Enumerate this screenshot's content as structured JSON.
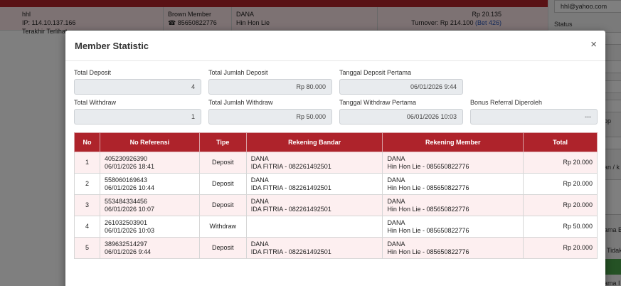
{
  "background": {
    "row": {
      "user": "hhl",
      "ip": "IP: 114.10.137.166",
      "last_login": "Terakhir Terlihat",
      "level": "Brown Member",
      "phone": "85650822776",
      "bank": "DANA",
      "holder": "Hin Hon Lie",
      "balance": "Rp 20.135",
      "turnover_label": "Turnover:",
      "turnover_value": "Rp 214.100",
      "bet_count": "(Bet 426)"
    },
    "right_panel": {
      "email": "hhl@yahoo.com",
      "status_label": "Status",
      "frag_1": "pp",
      "frag_2": "an / k",
      "frag_3": "ama B",
      "frag_4": "Tidak",
      "frag_5": "ama I"
    }
  },
  "modal": {
    "title": "Member Statistic",
    "close_glyph": "×",
    "stats": {
      "total_deposit_label": "Total Deposit",
      "total_deposit_value": "4",
      "total_jumlah_deposit_label": "Total Jumlah Deposit",
      "total_jumlah_deposit_value": "Rp 80.000",
      "tanggal_deposit_pertama_label": "Tanggal Deposit Pertama",
      "tanggal_deposit_pertama_value": "06/01/2026 9:44",
      "total_withdraw_label": "Total Withdraw",
      "total_withdraw_value": "1",
      "total_jumlah_withdraw_label": "Total Jumlah Withdraw",
      "total_jumlah_withdraw_value": "Rp 50.000",
      "tanggal_withdraw_pertama_label": "Tanggal Withdraw Pertama",
      "tanggal_withdraw_pertama_value": "06/01/2026 10:03",
      "bonus_referral_label": "Bonus Referral Diperoleh",
      "bonus_referral_value": "---"
    },
    "table": {
      "headers": [
        "No",
        "No Referensi",
        "Tipe",
        "Rekening Bandar",
        "Rekening Member",
        "Total"
      ],
      "rows": [
        {
          "no": "1",
          "ref": "405230926390",
          "date": "06/01/2026 18:41",
          "tipe": "Deposit",
          "bandar_bank": "DANA",
          "bandar_acc": "IDA FITRIA - 082261492501",
          "member_bank": "DANA",
          "member_acc": "Hin Hon Lie - 085650822776",
          "total": "Rp 20.000"
        },
        {
          "no": "2",
          "ref": "558060169643",
          "date": "06/01/2026 10:44",
          "tipe": "Deposit",
          "bandar_bank": "DANA",
          "bandar_acc": "IDA FITRIA - 082261492501",
          "member_bank": "DANA",
          "member_acc": "Hin Hon Lie - 085650822776",
          "total": "Rp 20.000"
        },
        {
          "no": "3",
          "ref": "553484334456",
          "date": "06/01/2026 10:07",
          "tipe": "Deposit",
          "bandar_bank": "DANA",
          "bandar_acc": "IDA FITRIA - 082261492501",
          "member_bank": "DANA",
          "member_acc": "Hin Hon Lie - 085650822776",
          "total": "Rp 20.000"
        },
        {
          "no": "4",
          "ref": "261032503901",
          "date": "06/01/2026 10:03",
          "tipe": "Withdraw",
          "bandar_bank": "",
          "bandar_acc": "",
          "member_bank": "DANA",
          "member_acc": "Hin Hon Lie - 085650822776",
          "total": "Rp 50.000"
        },
        {
          "no": "5",
          "ref": "389632514297",
          "date": "06/01/2026 9:44",
          "tipe": "Deposit",
          "bandar_bank": "DANA",
          "bandar_acc": "IDA FITRIA - 082261492501",
          "member_bank": "DANA",
          "member_acc": "Hin Hon Lie - 085650822776",
          "total": "Rp 20.000"
        }
      ]
    }
  },
  "colors": {
    "brand_red": "#ae232b",
    "row_highlight": "#fdeff0",
    "link_blue": "#2a55b3"
  }
}
